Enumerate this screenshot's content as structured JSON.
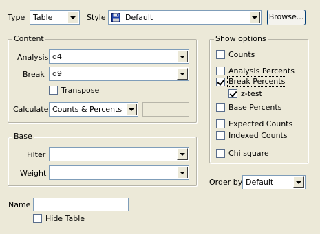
{
  "top": {
    "type_label": "Type",
    "type_value": "Table",
    "style_label": "Style",
    "style_value": "Default",
    "browse_label": "Browse..."
  },
  "content": {
    "title": "Content",
    "analysis_label": "Analysis",
    "analysis_value": "q4",
    "break_label": "Break",
    "break_value": "q9",
    "transpose_label": "Transpose",
    "calculate_label": "Calculate",
    "calculate_value": "Counts & Percents"
  },
  "base": {
    "title": "Base",
    "filter_label": "Filter",
    "filter_value": "",
    "weight_label": "Weight",
    "weight_value": ""
  },
  "show_options": {
    "title": "Show options",
    "items": [
      {
        "label": "Counts",
        "checked": false
      },
      {
        "label": "Analysis Percents",
        "checked": false
      },
      {
        "label": "Break Percents",
        "checked": true
      },
      {
        "label": "z-test",
        "checked": true
      },
      {
        "label": "Base Percents",
        "checked": false
      },
      {
        "label": "Expected Counts",
        "checked": false
      },
      {
        "label": "Indexed Counts",
        "checked": false
      },
      {
        "label": "Chi square",
        "checked": false
      }
    ]
  },
  "order_by": {
    "label": "Order by",
    "value": "Default"
  },
  "name": {
    "label": "Name",
    "value": ""
  },
  "hide_table_label": "Hide Table"
}
